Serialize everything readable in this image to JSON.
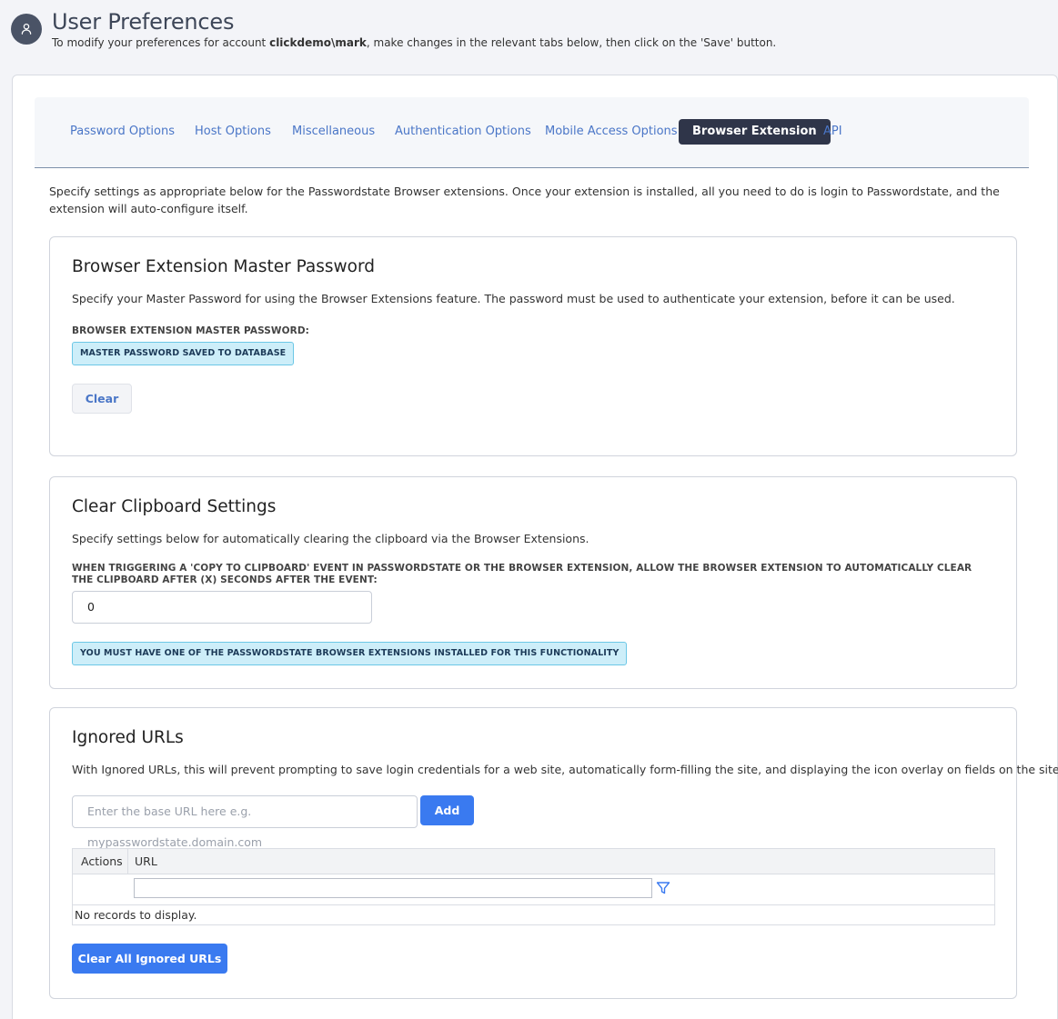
{
  "header": {
    "title": "User Preferences",
    "subtitle_pre": "To modify your preferences for account ",
    "account": "clickdemo\\mark",
    "subtitle_post": ", make changes in the relevant tabs below, then click on the 'Save' button."
  },
  "tabs": [
    {
      "label": "Password Options",
      "active": false
    },
    {
      "label": "Host Options",
      "active": false
    },
    {
      "label": "Miscellaneous",
      "active": false
    },
    {
      "label": "Authentication Options",
      "active": false
    },
    {
      "label": "Mobile Access Options",
      "active": false
    },
    {
      "label": "Browser Extension",
      "active": true
    },
    {
      "label": "API",
      "active": false
    }
  ],
  "intro": "Specify settings as appropriate below for the Passwordstate Browser extensions. Once your extension is installed, all you need to do is login to Passwordstate, and the extension will auto-configure itself.",
  "master_password": {
    "title": "Browser Extension Master Password",
    "description": "Specify your Master Password for using the Browser Extensions feature. The password must be used to authenticate your extension, before it can be used.",
    "field_label": "BROWSER EXTENSION MASTER PASSWORD:",
    "status_badge": "MASTER PASSWORD SAVED TO DATABASE",
    "clear_button": "Clear"
  },
  "clipboard": {
    "title": "Clear Clipboard Settings",
    "description": "Specify settings below for automatically clearing the clipboard via the Browser Extensions.",
    "field_label": "WHEN TRIGGERING A 'COPY TO CLIPBOARD' EVENT IN PASSWORDSTATE OR THE BROWSER EXTENSION, ALLOW THE BROWSER EXTENSION TO AUTOMATICALLY CLEAR THE CLIPBOARD AFTER (X) SECONDS AFTER THE EVENT:",
    "seconds_value": "0",
    "notice": "YOU MUST HAVE ONE OF THE PASSWORDSTATE BROWSER EXTENSIONS INSTALLED FOR THIS FUNCTIONALITY"
  },
  "ignored_urls": {
    "title": "Ignored URLs",
    "description": "With Ignored URLs, this will prevent prompting to save login credentials for a web site, automatically form-filling the site, and displaying the icon overlay on fields on the site.",
    "url_placeholder": "Enter the base URL here e.g. mypasswordstate.domain.com",
    "add_button": "Add",
    "columns": [
      "Actions",
      "URL"
    ],
    "empty_message": "No records to display.",
    "clear_all_button": "Clear All Ignored URLs"
  },
  "colors": {
    "accent": "#3a7af0",
    "tab_active_bg": "#2f3549",
    "tab_link": "#4a76c7",
    "info_badge_bg": "#cdeef9"
  }
}
